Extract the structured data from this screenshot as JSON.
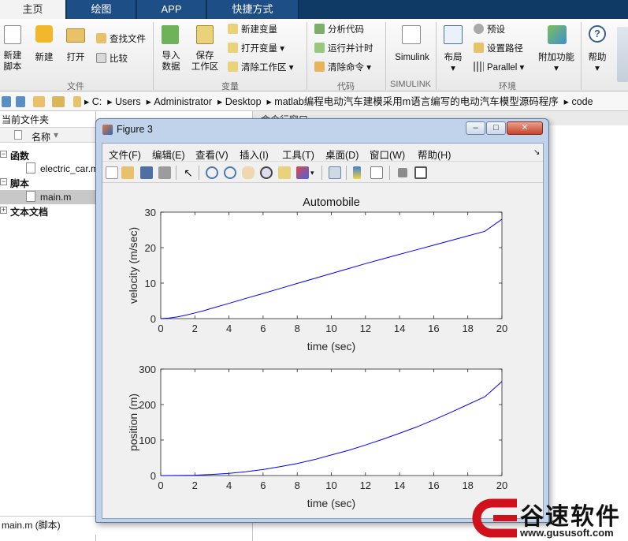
{
  "tabs": [
    {
      "label": "主页",
      "active": true
    },
    {
      "label": "绘图"
    },
    {
      "label": "APP"
    },
    {
      "label": "快捷方式"
    }
  ],
  "ribbon": {
    "file": {
      "new_script": "新建\n脚本",
      "new": "新建",
      "open": "打开",
      "find_files": "查找文件",
      "compare": "比较",
      "group": "文件"
    },
    "variable": {
      "import": "导入\n数据",
      "save_ws": "保存\n工作区",
      "new_var": "新建变量",
      "open_var": "打开变量",
      "clear_ws": "清除工作区",
      "group": "变量"
    },
    "code": {
      "analyze": "分析代码",
      "run_time": "运行并计时",
      "clear_cmd": "清除命令",
      "group": "代码"
    },
    "simulink": {
      "label": "Simulink",
      "group": "SIMULINK"
    },
    "env": {
      "layout": "布局",
      "prefs": "预设",
      "set_path": "设置路径",
      "parallel": "Parallel",
      "addons": "附加功能",
      "group": "环境"
    },
    "help": {
      "label": "帮助"
    }
  },
  "address": {
    "crumbs": [
      "C:",
      "Users",
      "Administrator",
      "Desktop",
      "matlab编程电动汽车建模采用m语言编写的电动汽车模型源码程序",
      "code"
    ]
  },
  "file_browser": {
    "title": "当前文件夹",
    "col_name": "名称",
    "groups": [
      {
        "label": "函数",
        "items": [
          "electric_car.m"
        ]
      },
      {
        "label": "脚本",
        "items": [
          "main.m"
        ]
      },
      {
        "label": "文本文档",
        "items": []
      }
    ]
  },
  "right_pane": {
    "title": "命令行窗口"
  },
  "status": {
    "text": "main.m  (脚本)"
  },
  "figure": {
    "title": "Figure 3",
    "menu": [
      "文件(F)",
      "编辑(E)",
      "查看(V)",
      "插入(I)",
      "工具(T)",
      "桌面(D)",
      "窗口(W)",
      "帮助(H)"
    ]
  },
  "chart_data": [
    {
      "type": "line",
      "title": "Automobile",
      "xlabel": "time (sec)",
      "ylabel": "velocity (m/sec)",
      "xlim": [
        0,
        20
      ],
      "ylim": [
        0,
        30
      ],
      "xticks": [
        0,
        2,
        4,
        6,
        8,
        10,
        12,
        14,
        16,
        18,
        20
      ],
      "yticks": [
        0,
        10,
        20,
        30
      ],
      "color": "#0000ff",
      "x": [
        0,
        0.5,
        1,
        1.5,
        2,
        2.5,
        3,
        4,
        5,
        6,
        7,
        8,
        9,
        10,
        11,
        12,
        13,
        14,
        15,
        16,
        17,
        18,
        19,
        20
      ],
      "y": [
        0,
        0.15,
        0.5,
        1.0,
        1.6,
        2.2,
        2.9,
        4.3,
        5.7,
        7.1,
        8.5,
        9.9,
        11.3,
        12.7,
        14.1,
        15.5,
        16.8,
        18.1,
        19.4,
        20.7,
        22.0,
        23.3,
        24.6,
        28.0
      ]
    },
    {
      "type": "line",
      "title": "",
      "xlabel": "time (sec)",
      "ylabel": "position (m)",
      "xlim": [
        0,
        20
      ],
      "ylim": [
        0,
        300
      ],
      "xticks": [
        0,
        2,
        4,
        6,
        8,
        10,
        12,
        14,
        16,
        18,
        20
      ],
      "yticks": [
        0,
        100,
        200,
        300
      ],
      "color": "#0000ff",
      "x": [
        0,
        1,
        2,
        3,
        4,
        5,
        6,
        7,
        8,
        9,
        10,
        11,
        12,
        13,
        14,
        15,
        16,
        17,
        18,
        19,
        20
      ],
      "y": [
        0,
        0.2,
        1,
        3,
        6,
        11,
        17,
        25,
        34,
        45,
        58,
        71,
        86,
        102,
        119,
        137,
        157,
        178,
        200,
        222,
        265
      ]
    }
  ],
  "watermark": {
    "brand": "谷速软件",
    "url": "www.gususoft.com",
    "color": "#d0101b"
  }
}
